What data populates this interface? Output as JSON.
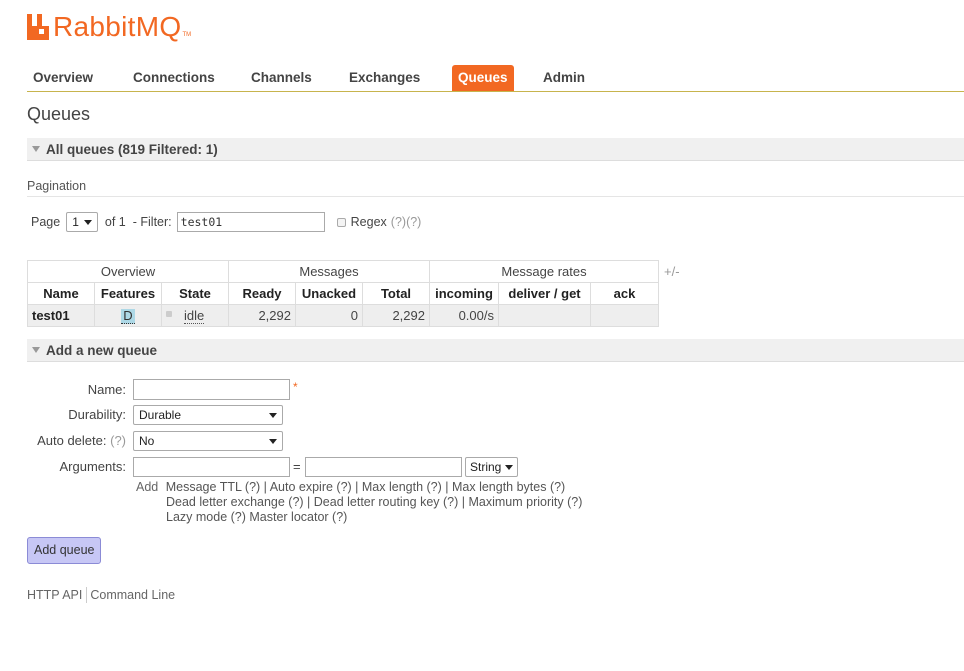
{
  "brand": {
    "name": "RabbitMQ",
    "tm": "TM",
    "accent": "#f26822"
  },
  "nav": {
    "items": [
      {
        "label": "Overview"
      },
      {
        "label": "Connections"
      },
      {
        "label": "Channels"
      },
      {
        "label": "Exchanges"
      },
      {
        "label": "Queues",
        "active": true
      },
      {
        "label": "Admin"
      }
    ]
  },
  "page": {
    "title": "Queues"
  },
  "all_queues": {
    "heading": "All queues (819 Filtered: 1)"
  },
  "pagination": {
    "label": "Pagination",
    "page_label": "Page",
    "page_value": "1",
    "of_label": "of 1",
    "filter_label": "- Filter:",
    "filter_value": "test01",
    "regex_label": "Regex",
    "help1": "(?)",
    "help2": "(?)"
  },
  "table": {
    "groups": [
      "Overview",
      "Messages",
      "Message rates"
    ],
    "plus_minus": "+/-",
    "columns": [
      "Name",
      "Features",
      "State",
      "Ready",
      "Unacked",
      "Total",
      "incoming",
      "deliver / get",
      "ack"
    ],
    "rows": [
      {
        "name": "test01",
        "features": "D",
        "state": "idle",
        "ready": "2,292",
        "unacked": "0",
        "total": "2,292",
        "incoming": "0.00/s",
        "deliver_get": "",
        "ack": ""
      }
    ]
  },
  "add_queue": {
    "heading": "Add a new queue",
    "name_label": "Name:",
    "required_mark": "*",
    "durability_label": "Durability:",
    "durability_value": "Durable",
    "auto_delete_label": "Auto delete:",
    "auto_delete_help": "(?)",
    "auto_delete_value": "No",
    "arguments_label": "Arguments:",
    "equals": "=",
    "arg_type": "String",
    "add_word": "Add",
    "arg_line1": "Message TTL (?) | Auto expire (?) | Max length (?) | Max length bytes (?)",
    "arg_line2": "Dead letter exchange (?) | Dead letter routing key (?) | Maximum priority (?)",
    "arg_line3": "Lazy mode (?) Master locator (?)",
    "button": "Add queue"
  },
  "footer": {
    "http_api": "HTTP API",
    "command_line": "Command Line"
  }
}
